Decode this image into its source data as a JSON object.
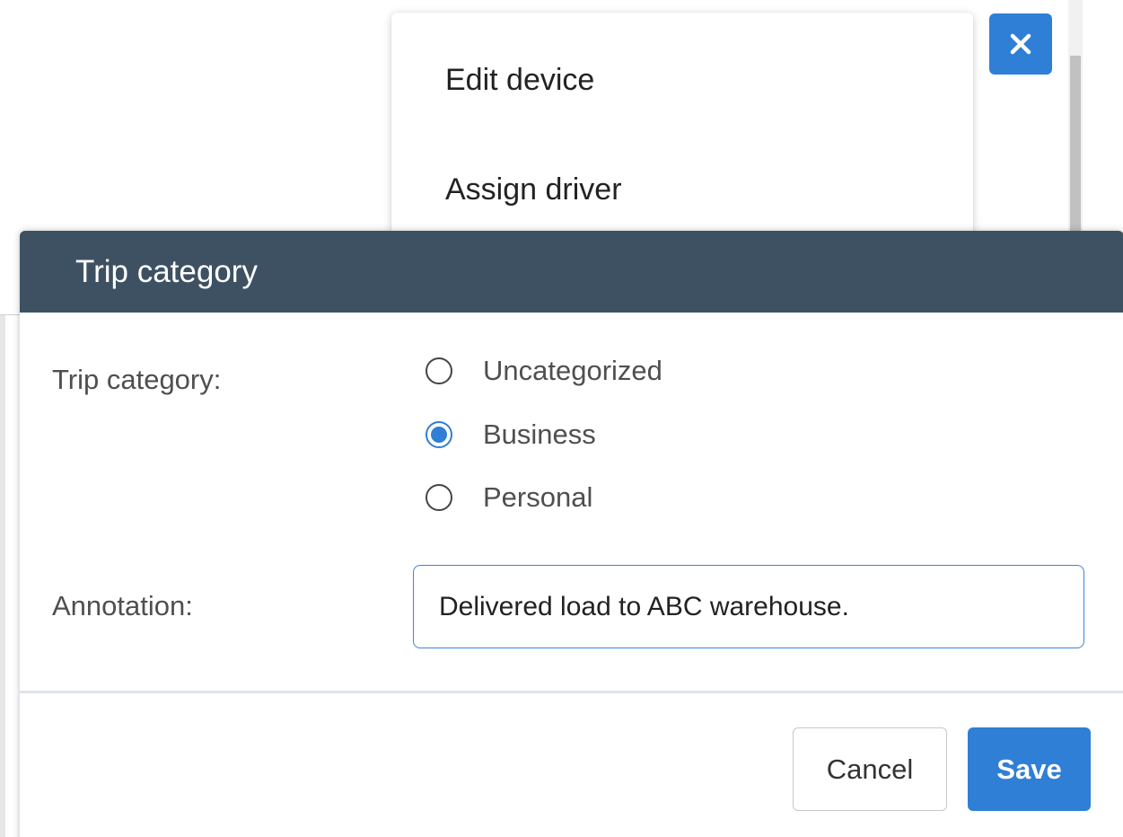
{
  "menu": {
    "items": [
      {
        "label": "Edit device"
      },
      {
        "label": "Assign driver"
      }
    ]
  },
  "dialog": {
    "title": "Trip category",
    "category_label": "Trip category:",
    "options": [
      {
        "label": "Uncategorized",
        "checked": false
      },
      {
        "label": "Business",
        "checked": true
      },
      {
        "label": "Personal",
        "checked": false
      }
    ],
    "annotation_label": "Annotation:",
    "annotation_value": "Delivered load to ABC warehouse.",
    "cancel_label": "Cancel",
    "save_label": "Save"
  },
  "icons": {
    "close": "close-icon"
  },
  "colors": {
    "accent": "#2f7fd6",
    "header": "#3e5163"
  }
}
